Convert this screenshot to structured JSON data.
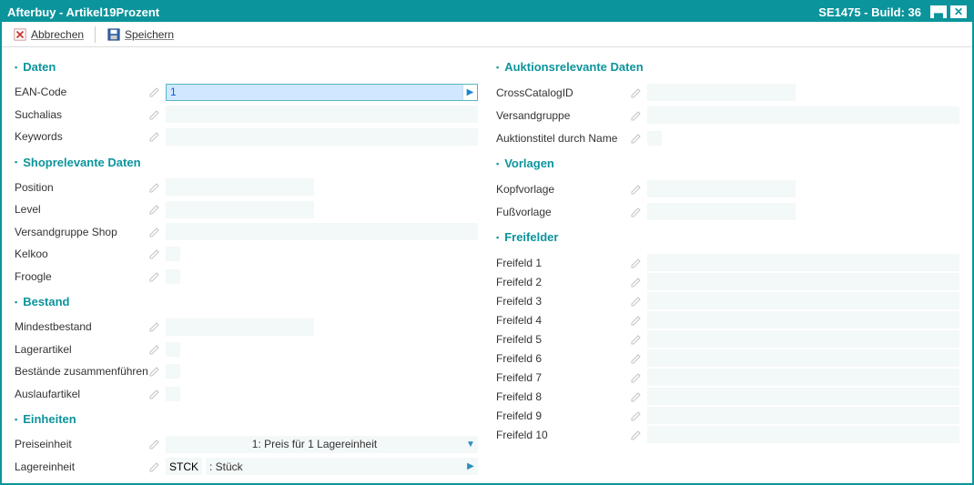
{
  "title_left": "Afterbuy - Artikel19Prozent",
  "title_right": "SE1475 - Build: 36",
  "toolbar": {
    "cancel": "Abbrechen",
    "save": "Speichern"
  },
  "left": {
    "daten": {
      "header": "Daten",
      "ean_label": "EAN-Code",
      "ean_value": "1",
      "suchalias_label": "Suchalias",
      "keywords_label": "Keywords"
    },
    "shop": {
      "header": "Shoprelevante Daten",
      "position_label": "Position",
      "level_label": "Level",
      "versandgruppe_label": "Versandgruppe Shop",
      "kelkoo_label": "Kelkoo",
      "froogle_label": "Froogle"
    },
    "bestand": {
      "header": "Bestand",
      "mindest_label": "Mindestbestand",
      "lagerartikel_label": "Lagerartikel",
      "zusammen_label": "Bestände zusammenführen",
      "auslauf_label": "Auslaufartikel"
    },
    "einheiten": {
      "header": "Einheiten",
      "preis_label": "Preiseinheit",
      "preis_value": "1: Preis für 1 Lagereinheit",
      "lager_label": "Lagereinheit",
      "lager_code": "STCK",
      "lager_value": ": Stück"
    }
  },
  "right": {
    "auktion": {
      "header": "Auktionsrelevante Daten",
      "cross_label": "CrossCatalogID",
      "versand_label": "Versandgruppe",
      "titel_label": "Auktionstitel durch Name"
    },
    "vorlagen": {
      "header": "Vorlagen",
      "kopf_label": "Kopfvorlage",
      "fuss_label": "Fußvorlage"
    },
    "freifelder": {
      "header": "Freifelder",
      "items": [
        "Freifeld 1",
        "Freifeld 2",
        "Freifeld 3",
        "Freifeld 4",
        "Freifeld 5",
        "Freifeld 6",
        "Freifeld 7",
        "Freifeld 8",
        "Freifeld 9",
        "Freifeld 10"
      ]
    }
  }
}
